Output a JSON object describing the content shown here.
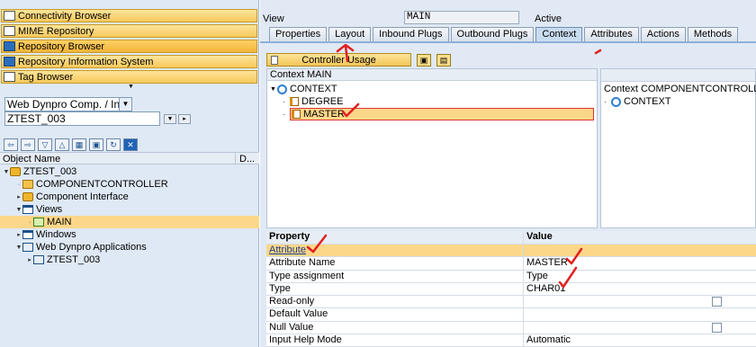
{
  "left": {
    "browsers": [
      {
        "label": "Connectivity Browser",
        "icon": "connectivity-icon",
        "active": false
      },
      {
        "label": "MIME Repository",
        "icon": "mime-icon",
        "active": false
      },
      {
        "label": "Repository Browser",
        "icon": "repository-icon",
        "active": true
      },
      {
        "label": "Repository Information System",
        "icon": "info-system-icon",
        "active": false
      },
      {
        "label": "Tag Browser",
        "icon": "tag-icon",
        "active": false
      }
    ],
    "object_type": "Web Dynpro Comp. / Intf.",
    "object_name": "ZTEST_003",
    "tree_header": {
      "name": "Object Name",
      "desc": "D..."
    },
    "tree": [
      {
        "label": "ZTEST_003",
        "icon": "component-icon"
      },
      {
        "label": "COMPONENTCONTROLLER",
        "icon": "controller-icon"
      },
      {
        "label": "Component Interface",
        "icon": "component-icon"
      },
      {
        "label": "Views",
        "icon": "views-folder-icon"
      },
      {
        "label": "MAIN",
        "icon": "view-icon"
      },
      {
        "label": "Windows",
        "icon": "windows-folder-icon"
      },
      {
        "label": "Web Dynpro Applications",
        "icon": "applications-folder-icon"
      },
      {
        "label": "ZTEST_003",
        "icon": "application-icon"
      }
    ]
  },
  "right": {
    "view_label": "View",
    "view_name": "MAIN",
    "view_status": "Active",
    "tabs": [
      "Properties",
      "Layout",
      "Inbound Plugs",
      "Outbound Plugs",
      "Context",
      "Attributes",
      "Actions",
      "Methods"
    ],
    "active_tab": "Context",
    "controller_usage_label": "Controller Usage",
    "context_left": {
      "header": "Context MAIN",
      "root": "CONTEXT",
      "attributes": [
        "DEGREE",
        "MASTER"
      ]
    },
    "context_right": {
      "header": "Context COMPONENTCONTROLLER",
      "root": "CONTEXT"
    },
    "properties": {
      "headers": [
        "Property",
        "Value"
      ],
      "group": "Attribute",
      "rows": [
        {
          "property": "Attribute Name",
          "value": "MASTER",
          "checkbox": false
        },
        {
          "property": "Type assignment",
          "value": "Type",
          "checkbox": false
        },
        {
          "property": "Type",
          "value": "CHAR01",
          "checkbox": false
        },
        {
          "property": "Read-only",
          "value": "",
          "checkbox": true
        },
        {
          "property": "Default Value",
          "value": "",
          "checkbox": false
        },
        {
          "property": "Null Value",
          "value": "",
          "checkbox": true
        },
        {
          "property": "Input Help Mode",
          "value": "Automatic",
          "checkbox": false
        }
      ]
    }
  },
  "colors": {
    "accent_yellow": "#f7c95c",
    "selection": "#fbd789",
    "pane_bg": "#dfe9f5",
    "annotation_red": "#e02020"
  }
}
